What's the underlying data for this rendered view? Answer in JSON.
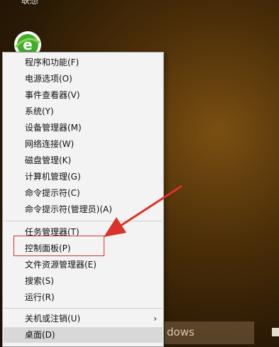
{
  "desktop": {
    "top_label": "联想"
  },
  "menu": {
    "items": [
      {
        "label": "程序和功能(F)"
      },
      {
        "label": "电源选项(O)"
      },
      {
        "label": "事件查看器(V)"
      },
      {
        "label": "系统(Y)"
      },
      {
        "label": "设备管理器(M)"
      },
      {
        "label": "网络连接(W)"
      },
      {
        "label": "磁盘管理(K)"
      },
      {
        "label": "计算机管理(G)"
      },
      {
        "label": "命令提示符(C)"
      },
      {
        "label": "命令提示符(管理员)(A)"
      },
      {
        "label": "任务管理器(T)"
      },
      {
        "label": "控制面板(P)"
      },
      {
        "label": "文件资源管理器(E)"
      },
      {
        "label": "搜索(S)"
      },
      {
        "label": "运行(R)"
      },
      {
        "label": "关机或注销(U)",
        "submenu": "›"
      },
      {
        "label": "桌面(D)"
      }
    ]
  },
  "taskbar": {
    "search_text": "dows"
  },
  "colors": {
    "annotation_red": "#d9332b",
    "menu_bg": "#f3f3f3",
    "hover_bg": "#d8d8d8"
  }
}
